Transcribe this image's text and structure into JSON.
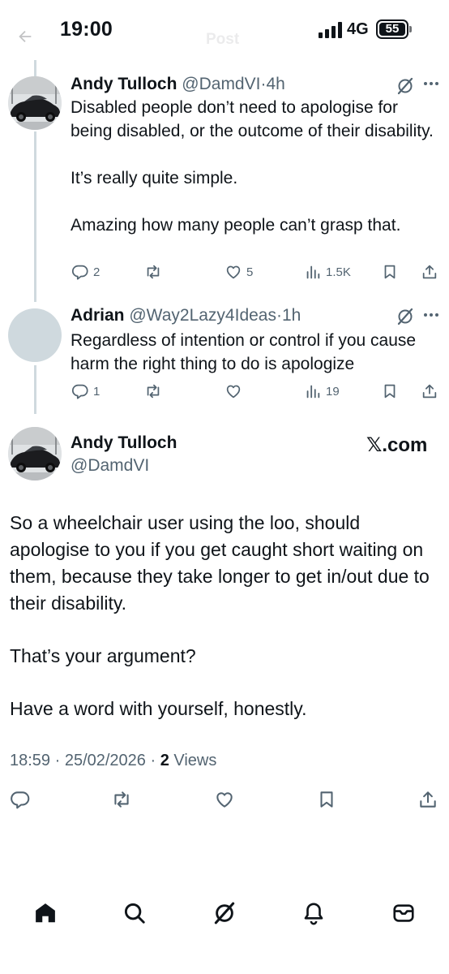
{
  "status_bar": {
    "time": "19:00",
    "network": "4G",
    "battery": "55",
    "header_title": "Post"
  },
  "replies": [
    {
      "name": "Andy Tulloch",
      "handle": "@DamdVI",
      "time": "4h",
      "avatar": "car-photo",
      "paragraphs": [
        "Disabled people don’t need to apologise for being disabled, or the outcome of their disability.",
        "It’s really quite simple.",
        "Amazing how many people can’t grasp that."
      ],
      "actions": {
        "replies": "2",
        "reposts": "",
        "likes": "5",
        "views": "1.5K"
      }
    },
    {
      "name": "Adrian",
      "handle": "@Way2Lazy4Ideas",
      "time": "1h",
      "avatar": "default-gray",
      "paragraphs": [
        "Regardless of intention or control if you cause harm the right thing to do is apologize"
      ],
      "actions": {
        "replies": "1",
        "reposts": "",
        "likes": "",
        "views": "19"
      }
    }
  ],
  "main_post": {
    "name": "Andy Tulloch",
    "handle": "@DamdVI",
    "watermark": "𝕏.com",
    "paragraphs": [
      "So a wheelchair user using the loo, should apologise to you if you get caught short waiting on them, because they take longer to get in/out due to their disability.",
      "That’s your argument?",
      "Have a word with yourself, honestly."
    ],
    "timestamp": "18:59 · 25/02/2026 · ",
    "views_count": "2",
    "views_label": " Views"
  },
  "separator": "·",
  "icons": {
    "action_bar": [
      "reply-icon",
      "repost-icon",
      "like-icon",
      "views-icon",
      "bookmark-icon",
      "share-icon"
    ],
    "bottom_nav": [
      "home-icon",
      "search-icon",
      "grok-icon",
      "notifications-icon",
      "messages-icon"
    ]
  },
  "colors": {
    "text": "#0f1419",
    "secondary": "#536471",
    "thread_line": "#cfd9de"
  }
}
